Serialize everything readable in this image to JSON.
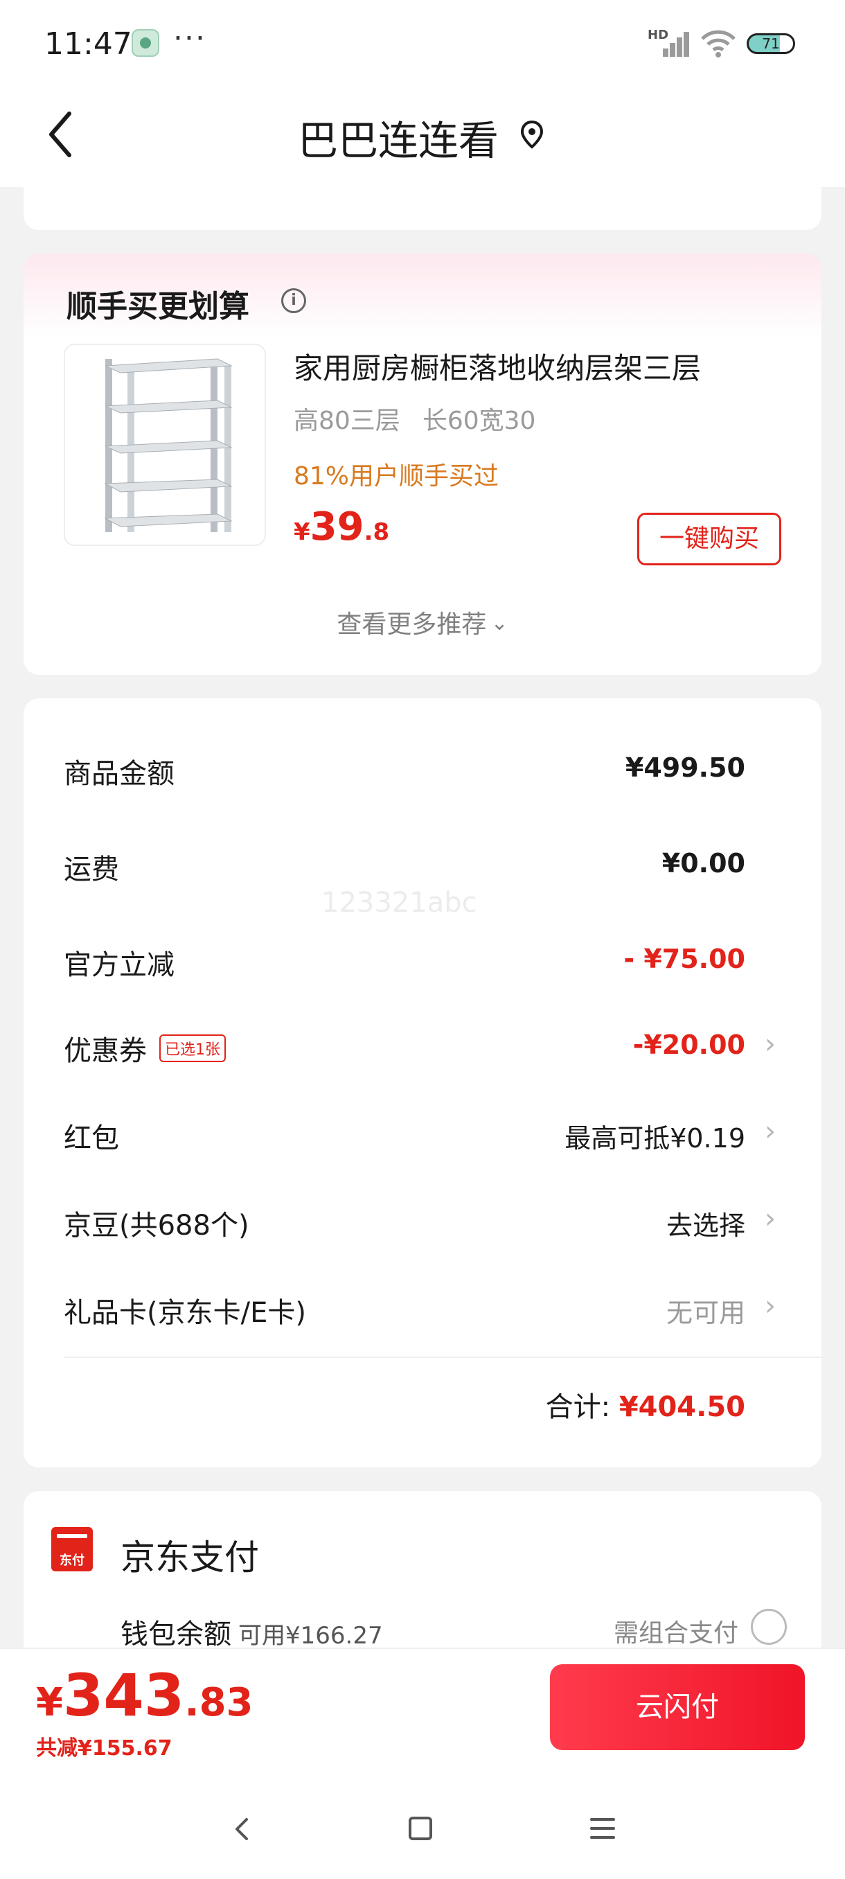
{
  "status_bar": {
    "time": "11:47",
    "dots": "···",
    "network": "HD",
    "battery": "71"
  },
  "header": {
    "title": "巴巴连连看"
  },
  "recommend": {
    "title": "顺手买更划算",
    "product": {
      "name": "家用厨房橱柜落地收纳层架三层",
      "spec_1": "高80三层",
      "spec_2": "长60宽30",
      "buyers": "81%用户顺手买过",
      "price_symbol": "¥",
      "price_int": "39",
      "price_dec": ".8",
      "buy_label": "一键购买"
    },
    "more_label": "查看更多推荐"
  },
  "summary": {
    "watermark": "123321abc",
    "rows": [
      {
        "label": "商品金额",
        "value": "¥499.50"
      },
      {
        "label": "运费",
        "value": "¥0.00"
      },
      {
        "label": "官方立减",
        "value": "- ¥75.00"
      },
      {
        "label": "优惠券",
        "tag": "已选1张",
        "value": "-¥20.00"
      },
      {
        "label": "红包",
        "value": "最高可抵¥0.19"
      },
      {
        "label": "京豆(共688个)",
        "value": "去选择"
      },
      {
        "label": "礼品卡(京东卡/E卡)",
        "value": "无可用"
      }
    ],
    "total_label": "合计:",
    "total_value": "¥404.50"
  },
  "payment": {
    "icon_text": "东付",
    "title": "京东支付",
    "wallet_label": "钱包余额",
    "wallet_available": "可用¥166.27",
    "wallet_note": "需组合支付"
  },
  "bottom": {
    "price_symbol": "¥",
    "price_int": "343",
    "price_dec": ".83",
    "saved": "共减¥155.67",
    "pay_label": "云闪付"
  },
  "colors": {
    "accent_red": "#e2231a",
    "orange": "#d97a1f"
  }
}
